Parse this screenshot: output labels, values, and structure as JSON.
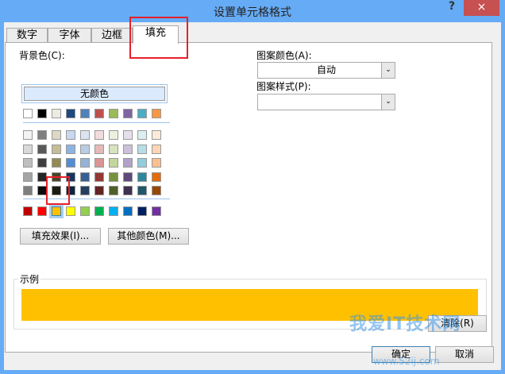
{
  "window": {
    "title": "设置单元格格式",
    "help": "?",
    "close": "×"
  },
  "tabs": [
    {
      "label": "数字"
    },
    {
      "label": "字体"
    },
    {
      "label": "边框"
    },
    {
      "label": "填充",
      "active": true
    }
  ],
  "fill": {
    "background_label": "背景色(C):",
    "no_color": "无颜色",
    "theme_row": [
      "#ffffff",
      "#000000",
      "#eeece1",
      "#1f497d",
      "#4f81bd",
      "#c0504d",
      "#9bbb59",
      "#8064a2",
      "#4bacc6",
      "#f79646"
    ],
    "tint_rows": [
      [
        "#f2f2f2",
        "#7f7f7f",
        "#ddd9c3",
        "#c6d9f0",
        "#dbe5f1",
        "#f2dcdb",
        "#ebf1dd",
        "#e5e0ec",
        "#dbeef3",
        "#fdeada"
      ],
      [
        "#d8d8d8",
        "#595959",
        "#c4bd97",
        "#8db3e2",
        "#b8cce4",
        "#e5b9b7",
        "#d7e3bc",
        "#ccc1d9",
        "#b7dde8",
        "#fbd5b5"
      ],
      [
        "#bfbfbf",
        "#3f3f3f",
        "#938953",
        "#548dd4",
        "#95b3d7",
        "#d99694",
        "#c3d69b",
        "#b2a2c7",
        "#92cddc",
        "#fac08f"
      ],
      [
        "#a5a5a5",
        "#262626",
        "#494429",
        "#17365d",
        "#366092",
        "#953734",
        "#76923c",
        "#5f497a",
        "#31859b",
        "#e36c09"
      ],
      [
        "#7f7f7f",
        "#0c0c0c",
        "#1d1b10",
        "#0f243e",
        "#244061",
        "#632423",
        "#4f6128",
        "#3f3151",
        "#205867",
        "#974806"
      ]
    ],
    "standard_row": [
      "#c00000",
      "#ff0000",
      "#ffc000",
      "#ffff00",
      "#92d050",
      "#00b050",
      "#00b0f0",
      "#0070c0",
      "#002060",
      "#7030a0"
    ],
    "selected_index": 2,
    "fill_effects": "填充效果(I)...",
    "more_colors": "其他颜色(M)...",
    "pattern_color_label": "图案颜色(A):",
    "pattern_color_value": "自动",
    "pattern_style_label": "图案样式(P):",
    "pattern_style_value": "",
    "sample_label": "示例",
    "sample_color": "#ffc000",
    "clear": "清除(R)"
  },
  "buttons": {
    "ok": "确定",
    "cancel": "取消"
  },
  "watermark": {
    "text": "我爱IT技术网",
    "url": "www.52ij.com"
  }
}
